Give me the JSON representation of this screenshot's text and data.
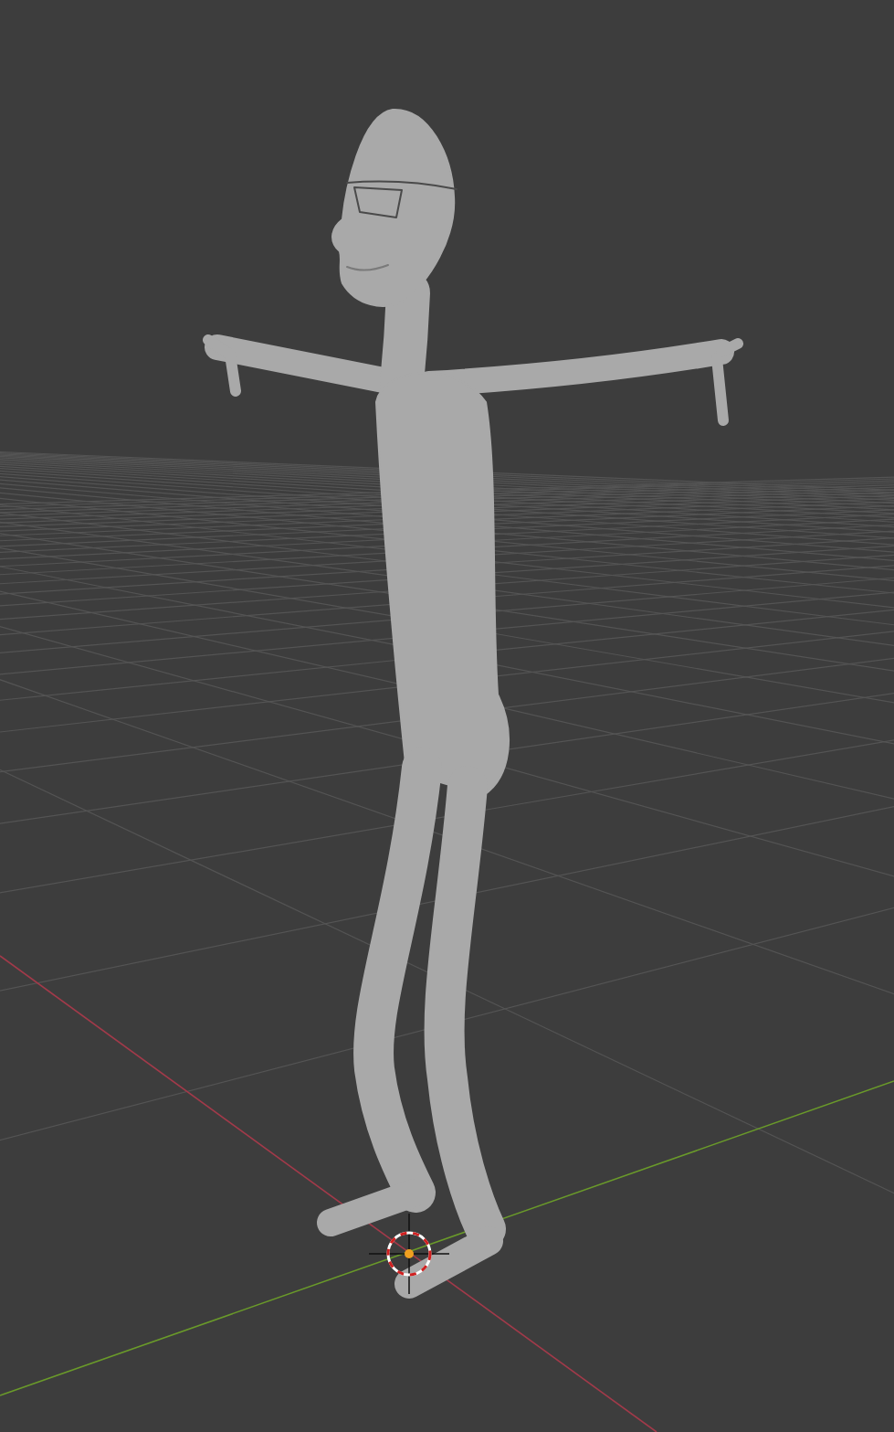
{
  "viewport": {
    "show_floor_grid": true,
    "show_axes": true,
    "show_3d_cursor": true
  }
}
